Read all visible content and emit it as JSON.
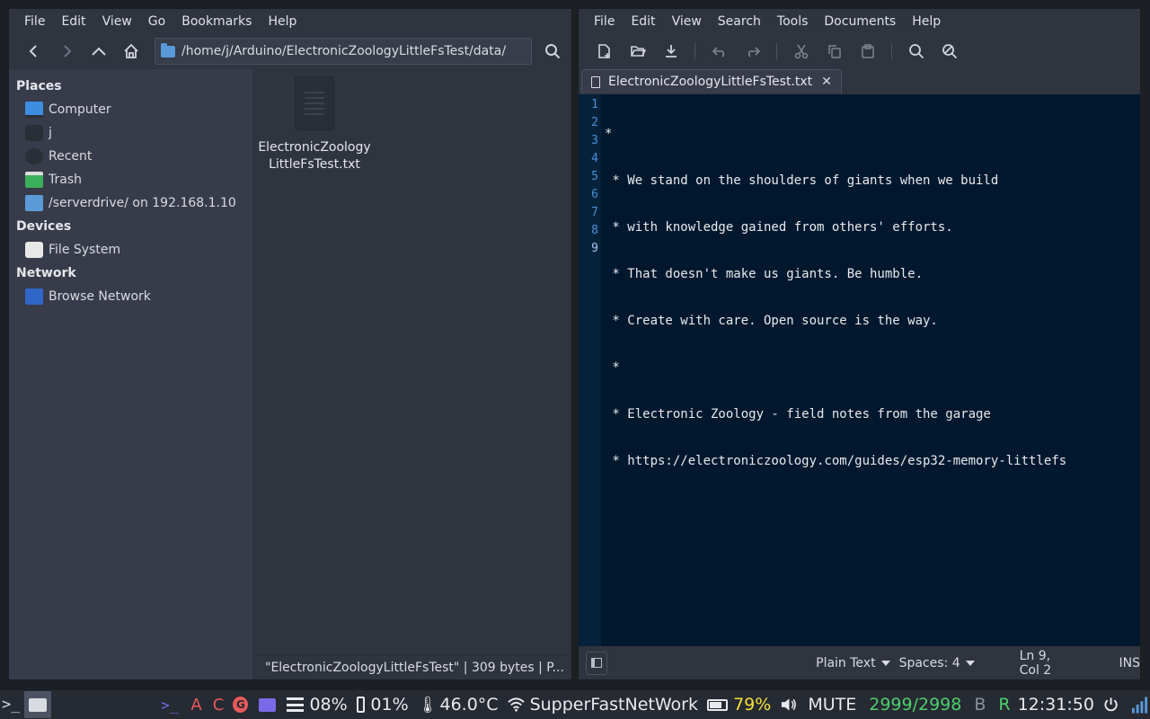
{
  "file_manager": {
    "menu": [
      "File",
      "Edit",
      "View",
      "Go",
      "Bookmarks",
      "Help"
    ],
    "path": "/home/j/Arduino/ElectronicZoologyLittleFsTest/data/",
    "sidebar": {
      "places_header": "Places",
      "places": [
        {
          "label": "Computer",
          "icon": "computer-icon"
        },
        {
          "label": "j",
          "icon": "home-folder-icon"
        },
        {
          "label": "Recent",
          "icon": "recent-icon"
        },
        {
          "label": "Trash",
          "icon": "trash-icon"
        },
        {
          "label": "/serverdrive/ on 192.168.1.10",
          "icon": "network-folder-icon"
        }
      ],
      "devices_header": "Devices",
      "devices": [
        {
          "label": "File System",
          "icon": "drive-icon"
        }
      ],
      "network_header": "Network",
      "network": [
        {
          "label": "Browse Network",
          "icon": "network-icon"
        }
      ]
    },
    "files": [
      {
        "name": "ElectronicZoologyLittleFsTest.txt",
        "icon": "text-file-icon"
      }
    ],
    "status": "\"ElectronicZoologyLittleFsTest\"  |  309 bytes  |  P..."
  },
  "editor": {
    "menu": [
      "File",
      "Edit",
      "View",
      "Search",
      "Tools",
      "Documents",
      "Help"
    ],
    "tab_title": "ElectronicZoologyLittleFsTest.txt",
    "line_numbers": [
      "1",
      "2",
      "3",
      "4",
      "5",
      "6",
      "7",
      "8",
      "9"
    ],
    "lines": [
      "*",
      " * We stand on the shoulders of giants when we build",
      " * with knowledge gained from others' efforts.",
      " * That doesn't make us giants. Be humble.",
      " * Create with care. Open source is the way.",
      " *",
      " * Electronic Zoology - field notes from the garage",
      " * https://electroniczoology.com/guides/esp32-memory-littlefs",
      ""
    ],
    "status": {
      "language": "Plain Text",
      "spaces": "Spaces: 4",
      "position": "Ln 9, Col 2",
      "mode": "INS"
    }
  },
  "taskbar": {
    "terminal": ">_",
    "launchers": {
      "terminal": ">_",
      "a": "A",
      "c": "C",
      "g": "G"
    },
    "cpu": "08%",
    "mem": "01%",
    "temp": "46.0°C",
    "wifi": "SupperFastNetWork",
    "battery": "79%",
    "volume": "MUTE",
    "net": "2999/2998",
    "b": "B",
    "r": "R",
    "clock": "12:31:50",
    "colors": {
      "battery": "#f4e23a",
      "net": "#4cd06a",
      "r": "#4cd06a",
      "a": "#e85a5a",
      "c": "#e85a5a",
      "g": "#e85a5a",
      "launcher": "#7a6ae8"
    }
  }
}
